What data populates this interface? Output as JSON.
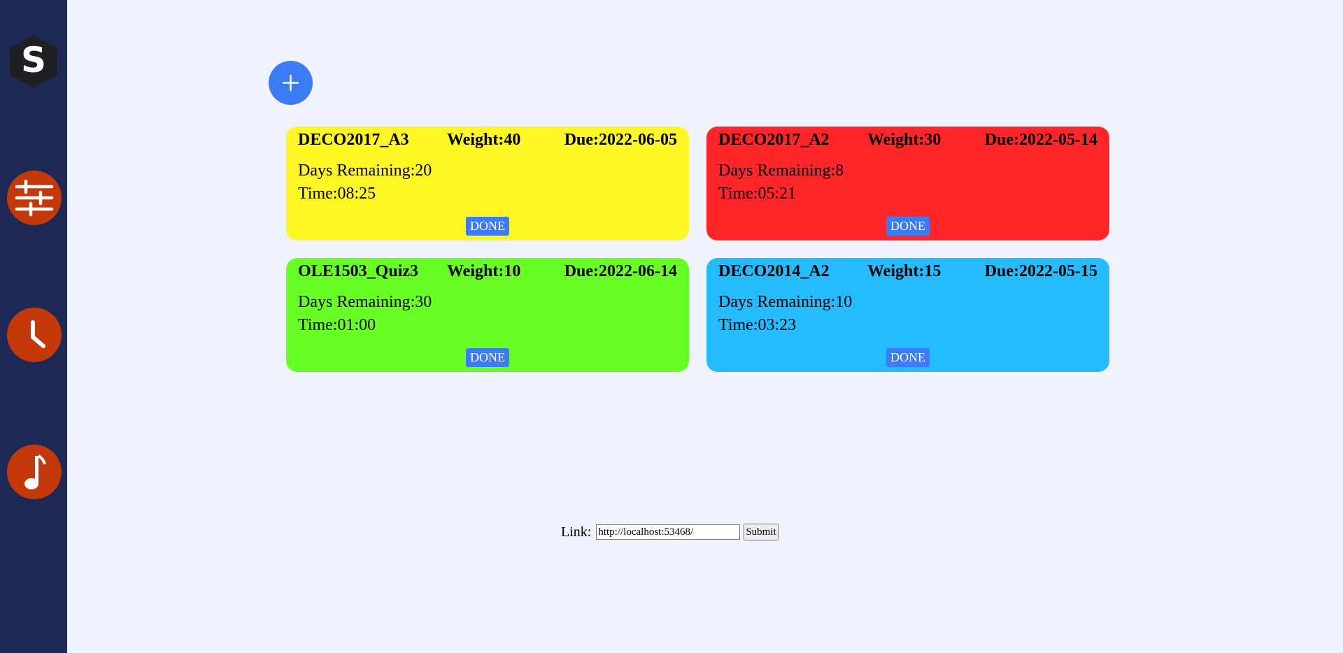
{
  "colors": {
    "sidebar_bg": "#1d2955",
    "page_bg": "#eef3fd",
    "nav_button": "#c4380a",
    "accent_blue": "#3b7bf6"
  },
  "sidebar": {
    "logo_letter": "S",
    "items": [
      {
        "icon": "sliders-icon"
      },
      {
        "icon": "clock-icon"
      },
      {
        "icon": "music-note-icon"
      }
    ]
  },
  "add_button": {
    "icon": "plus-icon"
  },
  "cards": [
    {
      "name": "DECO2017_A3",
      "weight": "Weight:40",
      "due": "Due:2022-06-05",
      "days_remaining": "Days Remaining:20",
      "time": "Time:08:25",
      "done_label": "DONE",
      "color": "#fff725"
    },
    {
      "name": "DECO2017_A2",
      "weight": "Weight:30",
      "due": "Due:2022-05-14",
      "days_remaining": "Days Remaining:8",
      "time": "Time:05:21",
      "done_label": "DONE",
      "color": "#ff2528"
    },
    {
      "name": "OLE1503_Quiz3",
      "weight": "Weight:10",
      "due": "Due:2022-06-14",
      "days_remaining": "Days Remaining:30",
      "time": "Time:01:00",
      "done_label": "DONE",
      "color": "#68ff25"
    },
    {
      "name": "DECO2014_A2",
      "weight": "Weight:15",
      "due": "Due:2022-05-15",
      "days_remaining": "Days Remaining:10",
      "time": "Time:03:23",
      "done_label": "DONE",
      "color": "#25bcff"
    }
  ],
  "link_form": {
    "label": "Link:",
    "value": "http://localhost:53468/",
    "submit_label": "Submit"
  }
}
